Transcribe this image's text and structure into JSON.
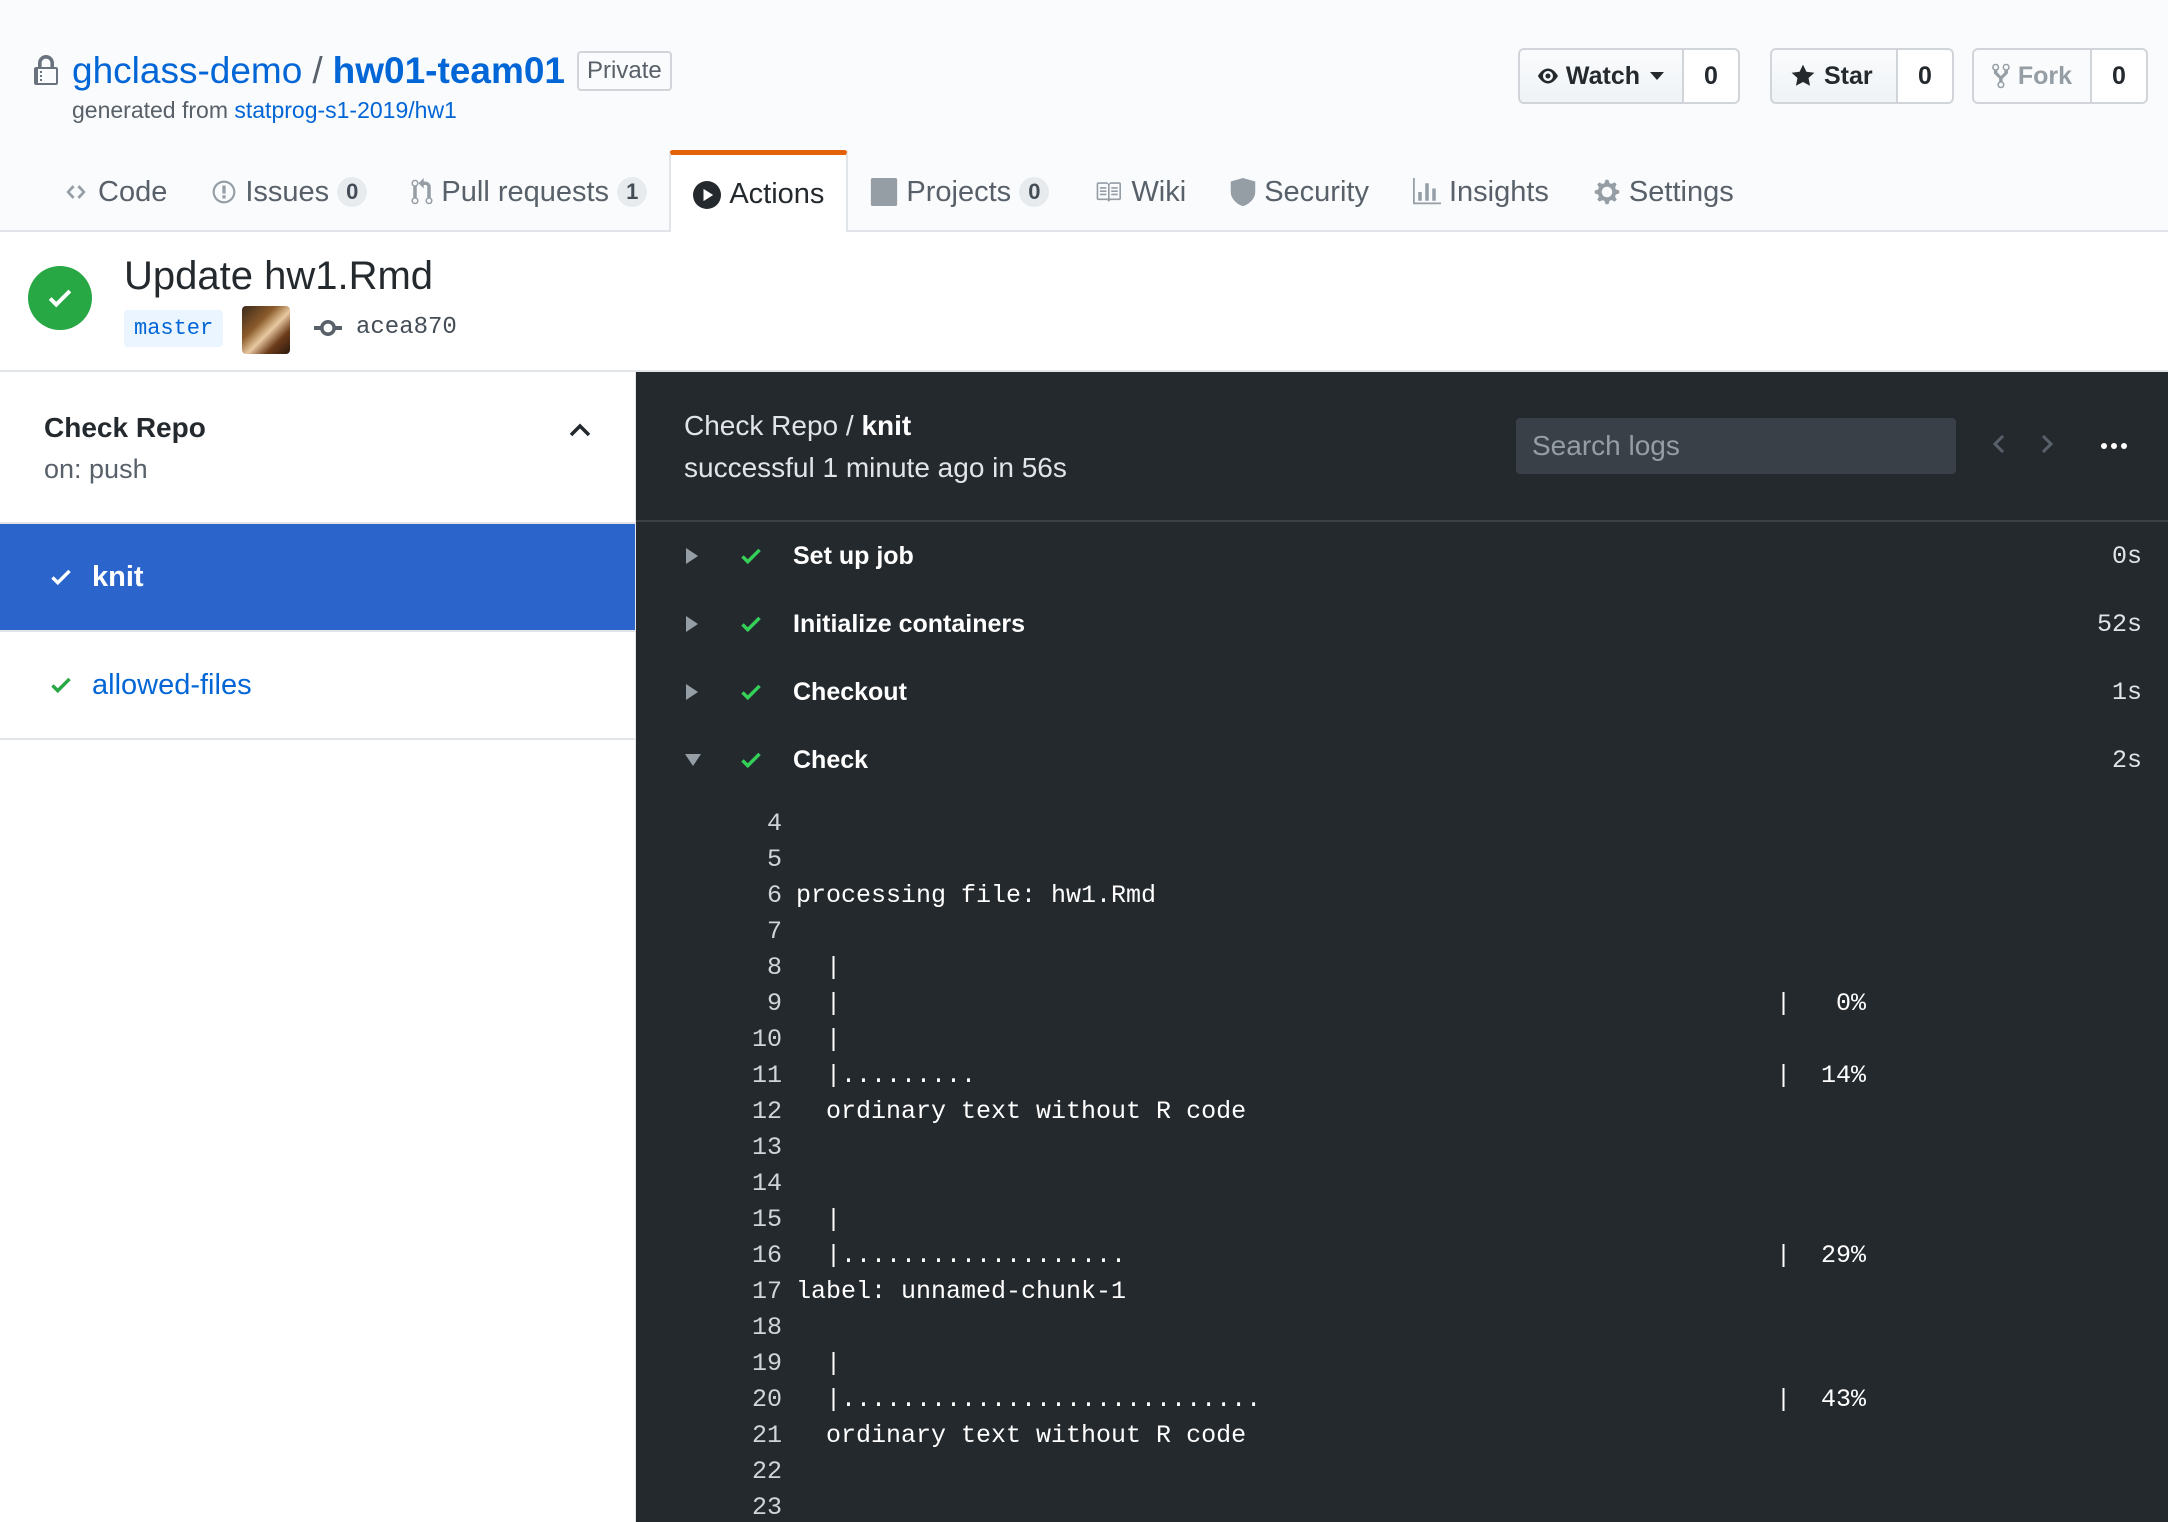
{
  "repo": {
    "owner": "ghclass-demo",
    "separator": "/",
    "name": "hw01-team01",
    "visibility": "Private",
    "generated_prefix": "generated from",
    "template": "statprog-s1-2019/hw1"
  },
  "social": {
    "watch_label": "Watch",
    "watch_count": "0",
    "star_label": "Star",
    "star_count": "0",
    "fork_label": "Fork",
    "fork_count": "0"
  },
  "tabs": [
    {
      "label": "Code",
      "icon": "code-icon"
    },
    {
      "label": "Issues",
      "icon": "issue-icon",
      "count": "0"
    },
    {
      "label": "Pull requests",
      "icon": "pull-request-icon",
      "count": "1"
    },
    {
      "label": "Actions",
      "icon": "play-icon",
      "selected": true
    },
    {
      "label": "Projects",
      "icon": "project-icon",
      "count": "0"
    },
    {
      "label": "Wiki",
      "icon": "book-icon"
    },
    {
      "label": "Security",
      "icon": "shield-icon"
    },
    {
      "label": "Insights",
      "icon": "graph-icon"
    },
    {
      "label": "Settings",
      "icon": "gear-icon"
    }
  ],
  "commit": {
    "title": "Update hw1.Rmd",
    "branch": "master",
    "sha": "acea870",
    "status_color": "#28a745"
  },
  "workflow": {
    "name": "Check Repo",
    "trigger": "on: push",
    "jobs": [
      {
        "label": "knit",
        "selected": true
      },
      {
        "label": "allowed-files",
        "selected": false
      }
    ]
  },
  "log": {
    "workflow": "Check Repo",
    "separator": " / ",
    "job": "knit",
    "summary": "successful 1 minute ago in 56s",
    "search_placeholder": "Search logs",
    "steps": [
      {
        "name": "Set up job",
        "duration": "0s",
        "expanded": false
      },
      {
        "name": "Initialize containers",
        "duration": "52s",
        "expanded": false
      },
      {
        "name": "Checkout",
        "duration": "1s",
        "expanded": false
      },
      {
        "name": "Check",
        "duration": "2s",
        "expanded": true
      }
    ],
    "lines": [
      {
        "n": "4",
        "text": "",
        "pct": ""
      },
      {
        "n": "5",
        "text": "",
        "pct": ""
      },
      {
        "n": "6",
        "text": "processing file: hw1.Rmd",
        "pct": ""
      },
      {
        "n": "7",
        "text": "",
        "pct": ""
      },
      {
        "n": "8",
        "text": "  |",
        "pct": ""
      },
      {
        "n": "9",
        "text": "  |",
        "pct": "|   0%"
      },
      {
        "n": "10",
        "text": "  |",
        "pct": ""
      },
      {
        "n": "11",
        "text": "  |.........",
        "pct": "|  14%"
      },
      {
        "n": "12",
        "text": "  ordinary text without R code",
        "pct": ""
      },
      {
        "n": "13",
        "text": "",
        "pct": ""
      },
      {
        "n": "14",
        "text": "",
        "pct": ""
      },
      {
        "n": "15",
        "text": "  |",
        "pct": ""
      },
      {
        "n": "16",
        "text": "  |...................",
        "pct": "|  29%"
      },
      {
        "n": "17",
        "text": "label: unnamed-chunk-1",
        "pct": ""
      },
      {
        "n": "18",
        "text": "",
        "pct": ""
      },
      {
        "n": "19",
        "text": "  |",
        "pct": ""
      },
      {
        "n": "20",
        "text": "  |............................",
        "pct": "|  43%"
      },
      {
        "n": "21",
        "text": "  ordinary text without R code",
        "pct": ""
      },
      {
        "n": "22",
        "text": "",
        "pct": ""
      },
      {
        "n": "23",
        "text": "",
        "pct": ""
      }
    ]
  }
}
